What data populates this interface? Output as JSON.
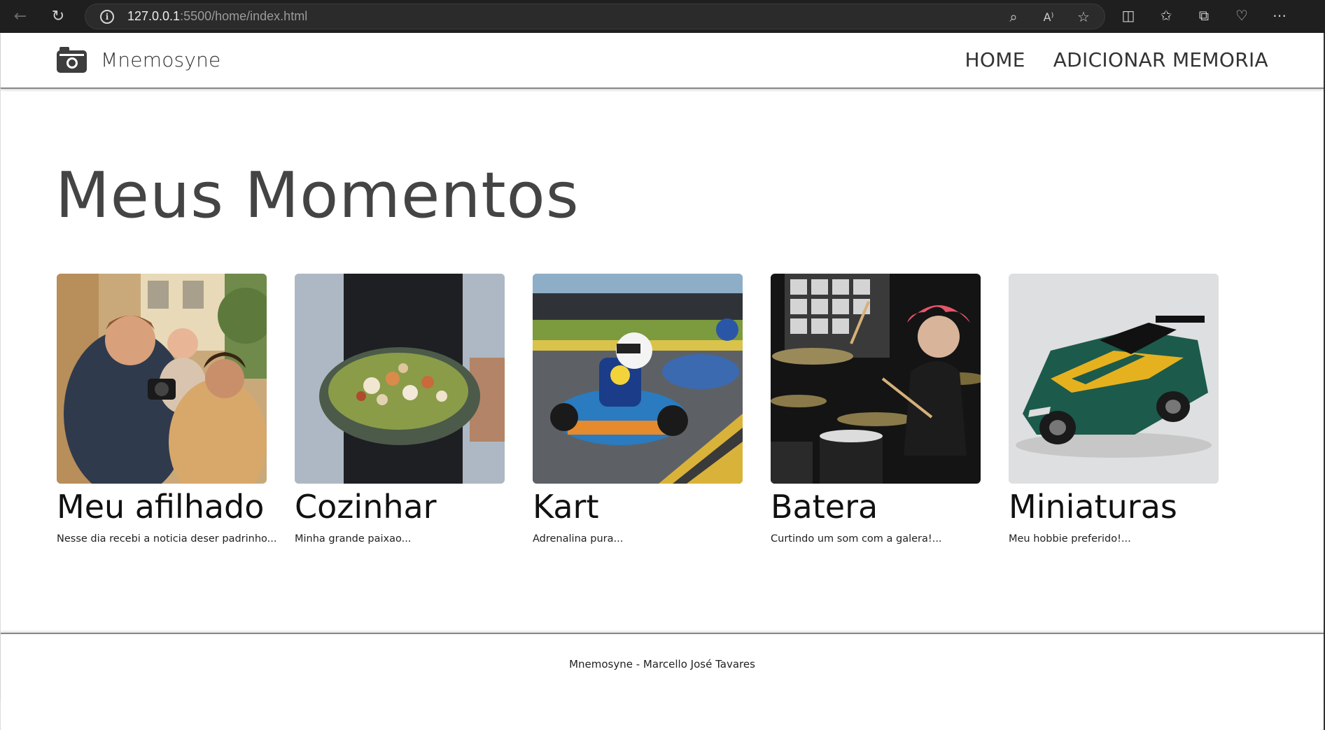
{
  "browser": {
    "url_host": "127.0.0.1",
    "url_rest": ":5500/home/index.html"
  },
  "header": {
    "brand": "Mnemosyne",
    "nav": [
      "HOME",
      "ADICIONAR MEMORIA"
    ]
  },
  "main": {
    "title": "Meus Momentos",
    "cards": [
      {
        "title": "Meu afilhado",
        "desc": "Nesse dia recebi a noticia deser padrinho..."
      },
      {
        "title": "Cozinhar",
        "desc": "Minha grande paixao..."
      },
      {
        "title": "Kart",
        "desc": "Adrenalina pura..."
      },
      {
        "title": "Batera",
        "desc": "Curtindo um som com a galera!..."
      },
      {
        "title": "Miniaturas",
        "desc": "Meu hobbie preferido!..."
      }
    ]
  },
  "footer": {
    "text": "Mnemosyne - Marcello José Tavares"
  }
}
